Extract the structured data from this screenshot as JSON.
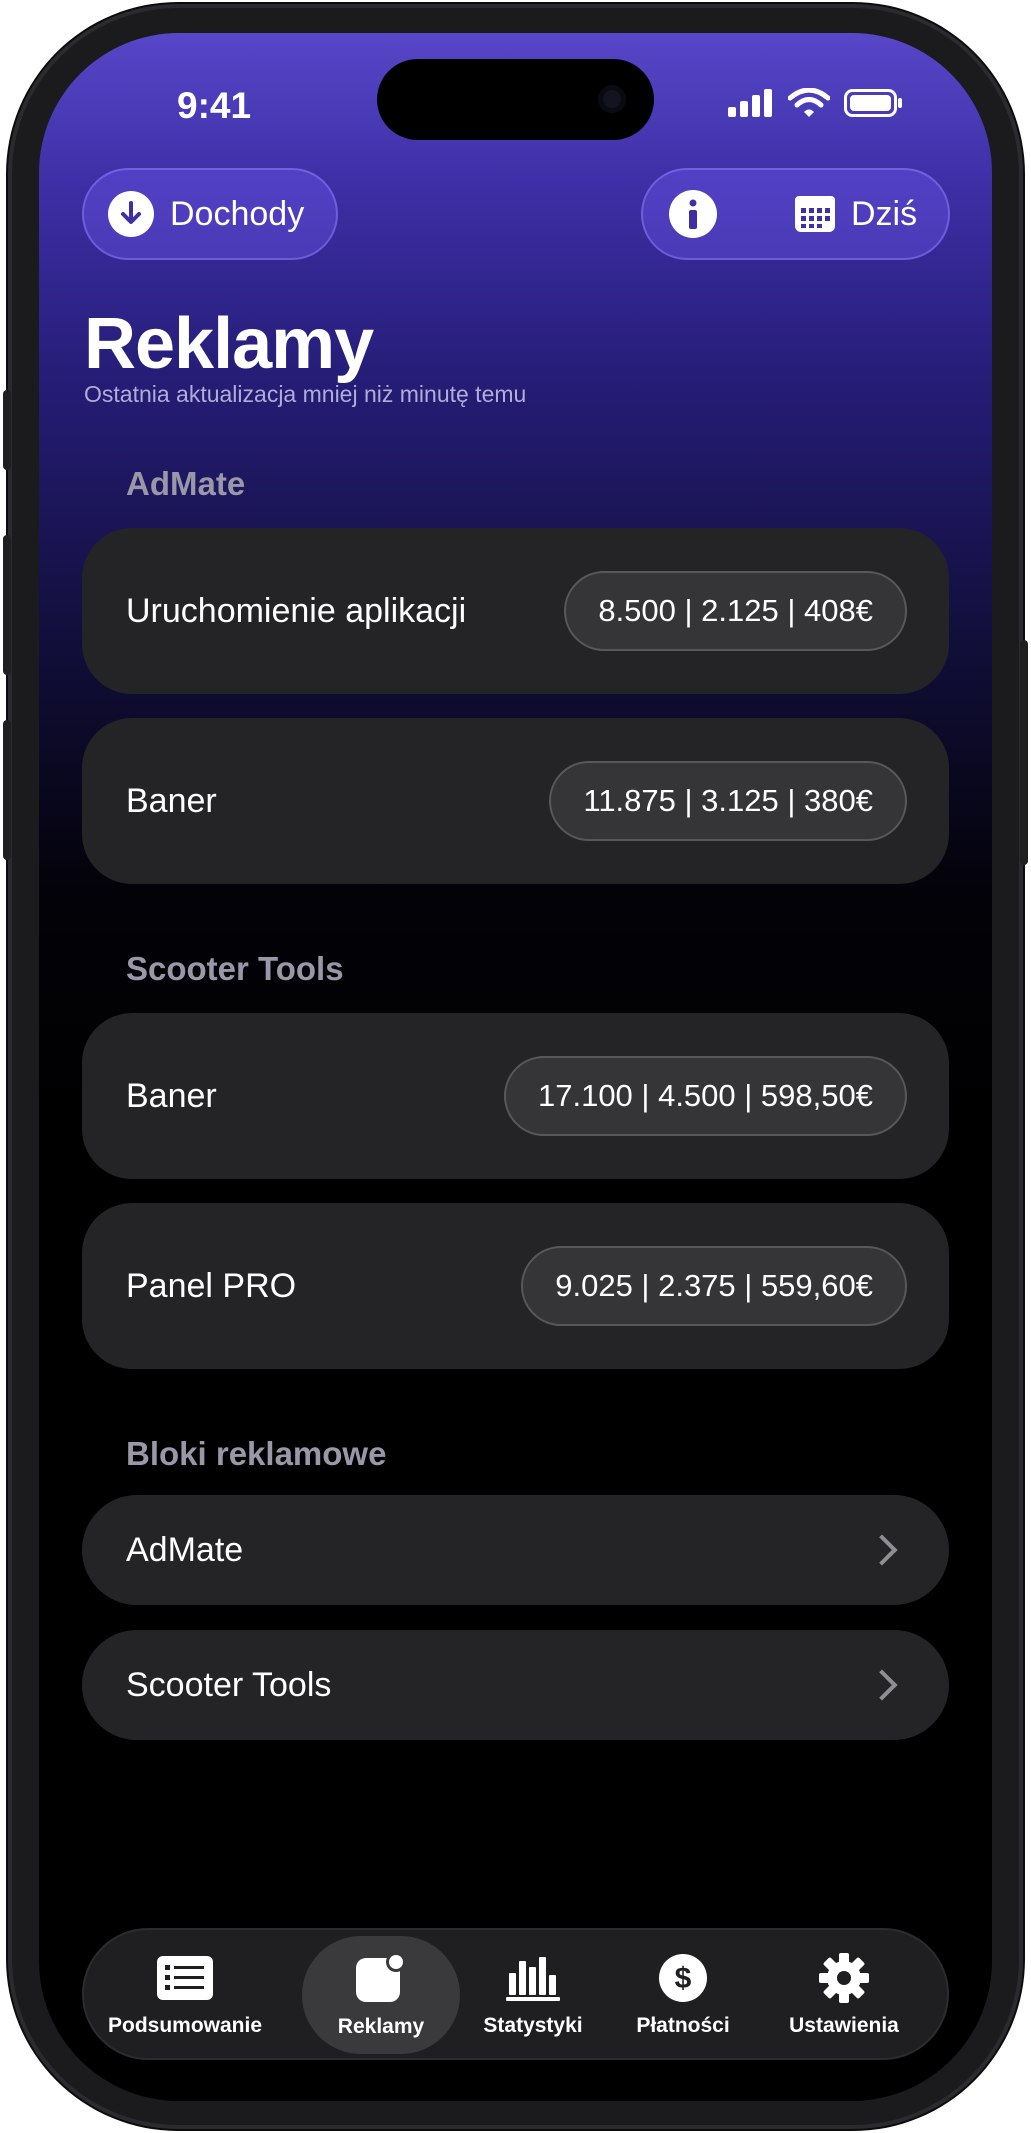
{
  "status_bar": {
    "time": "9:41"
  },
  "header": {
    "income_button_label": "Dochody",
    "date_button_label": "Dziś",
    "title": "Reklamy",
    "subtitle": "Ostatnia aktualizacja mniej niż minutę temu"
  },
  "sections": [
    {
      "title": "AdMate",
      "items": [
        {
          "label": "Uruchomienie aplikacji",
          "stats": "8.500 | 2.125 | 408€"
        },
        {
          "label": "Baner",
          "stats": "11.875 | 3.125 | 380€"
        }
      ]
    },
    {
      "title": "Scooter Tools",
      "items": [
        {
          "label": "Baner",
          "stats": "17.100 | 4.500 | 598,50€"
        },
        {
          "label": "Panel PRO",
          "stats": "9.025 | 2.375 | 559,60€"
        }
      ]
    },
    {
      "title": "Bloki reklamowe",
      "links": [
        {
          "label": "AdMate"
        },
        {
          "label": "Scooter Tools"
        }
      ]
    }
  ],
  "tabbar": {
    "active": "Reklamy",
    "tabs": [
      {
        "label": "Podsumowanie",
        "icon": "list-icon"
      },
      {
        "label": "Reklamy",
        "icon": "ad-app-icon"
      },
      {
        "label": "Statystyki",
        "icon": "bar-chart-icon"
      },
      {
        "label": "Płatności",
        "icon": "dollar-icon"
      },
      {
        "label": "Ustawienia",
        "icon": "gear-icon"
      }
    ]
  },
  "colors": {
    "accent_gradient_top": "#5747c9",
    "card_background": "#242426",
    "badge_background": "#353538"
  }
}
